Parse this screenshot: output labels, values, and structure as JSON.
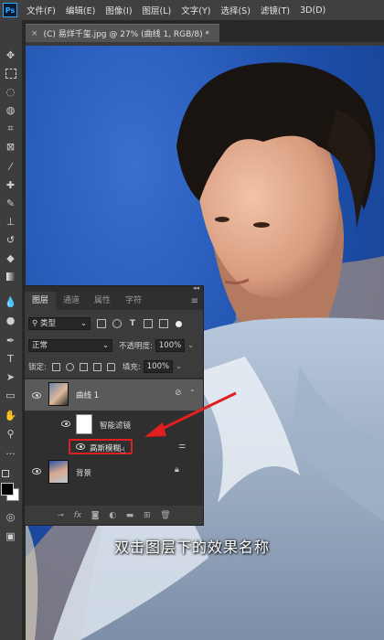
{
  "app": {
    "logo": "Ps",
    "menu": [
      "文件(F)",
      "编辑(E)",
      "图像(I)",
      "图层(L)",
      "文字(Y)",
      "选择(S)",
      "滤镜(T)",
      "3D(D)"
    ]
  },
  "document_tab": {
    "title": "(C) 易烊千玺.jpg @ 27% (曲线 1, RGB/8) *",
    "close": "×"
  },
  "layers_panel": {
    "tabs": [
      "图层",
      "通道",
      "属性",
      "字符"
    ],
    "filter_kind": "类型",
    "blend_mode": "正常",
    "opacity_label": "不透明度:",
    "opacity_value": "100%",
    "lock_label": "锁定:",
    "fill_label": "填充:",
    "fill_value": "100%",
    "layers": {
      "curves": {
        "name": "曲线 1"
      },
      "smart_filters": {
        "name": "智能滤镜"
      },
      "gaussian_blur": {
        "name": "高斯模糊"
      },
      "background": {
        "name": "背景"
      }
    },
    "footer_icons": [
      "link-icon",
      "fx-icon",
      "mask-icon",
      "adjustment-icon",
      "folder-icon",
      "new-layer-icon",
      "trash-icon"
    ],
    "footer_fx": "fx"
  },
  "subtitle": "双击图层下的效果名称",
  "colors": {
    "annotation_red": "#e02020",
    "canvas_blue": "#1e53b0"
  }
}
